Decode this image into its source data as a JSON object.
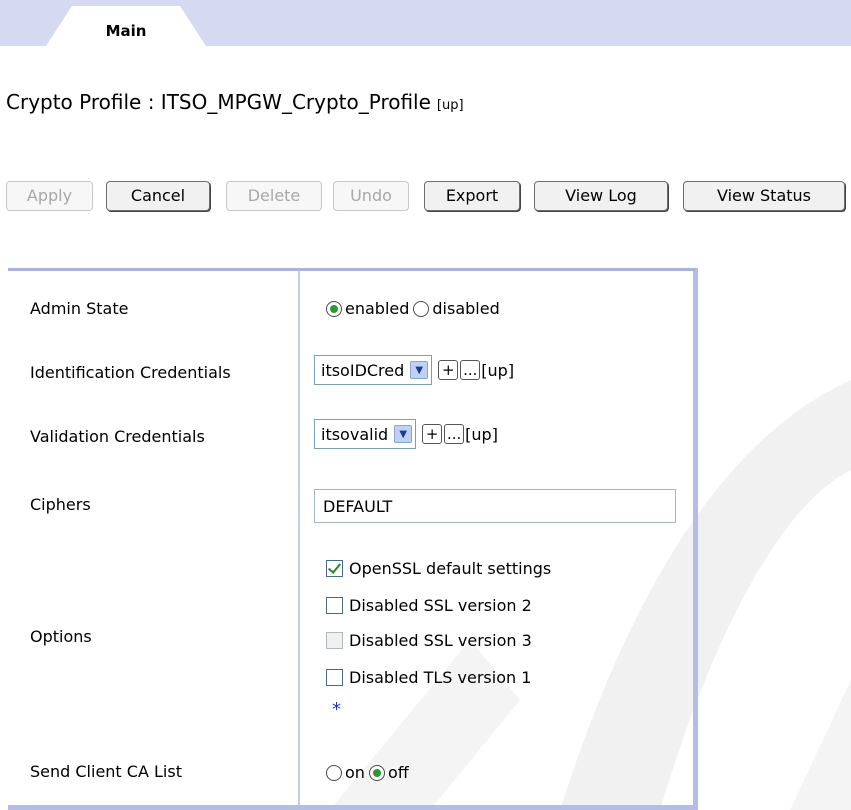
{
  "tabs": [
    {
      "label": "Main"
    }
  ],
  "page": {
    "title": "Crypto Profile : ITSO_MPGW_Crypto_Profile",
    "title_link": "[up]"
  },
  "toolbar": {
    "apply": "Apply",
    "cancel": "Cancel",
    "delete": "Delete",
    "undo": "Undo",
    "export": "Export",
    "view_log": "View Log",
    "view_status": "View Status"
  },
  "form": {
    "admin_state": {
      "label": "Admin State",
      "options": [
        "enabled",
        "disabled"
      ],
      "selected": "enabled"
    },
    "identification_credentials": {
      "label": "Identification Credentials",
      "value": "itsoIDCred",
      "add": "+",
      "edit": "...",
      "link": "[up]"
    },
    "validation_credentials": {
      "label": "Validation Credentials",
      "value": "itsovalid",
      "add": "+",
      "edit": "...",
      "link": "[up]"
    },
    "ciphers": {
      "label": "Ciphers",
      "value": "DEFAULT"
    },
    "options": {
      "label": "Options",
      "items": [
        {
          "label": "OpenSSL default settings",
          "checked": true
        },
        {
          "label": "Disabled SSL version 2",
          "checked": false
        },
        {
          "label": "Disabled SSL version 3",
          "checked": false
        },
        {
          "label": "Disabled TLS version 1",
          "checked": false
        }
      ],
      "required_marker": "*"
    },
    "send_client_ca_list": {
      "label": "Send Client CA List",
      "options": [
        "on",
        "off"
      ],
      "selected": "off"
    }
  },
  "colors": {
    "tab_strip": "#d5daf2",
    "form_border": "#b4bde6",
    "radio_dot": "#2a9a2a",
    "required_star": "#1c3ca0"
  }
}
